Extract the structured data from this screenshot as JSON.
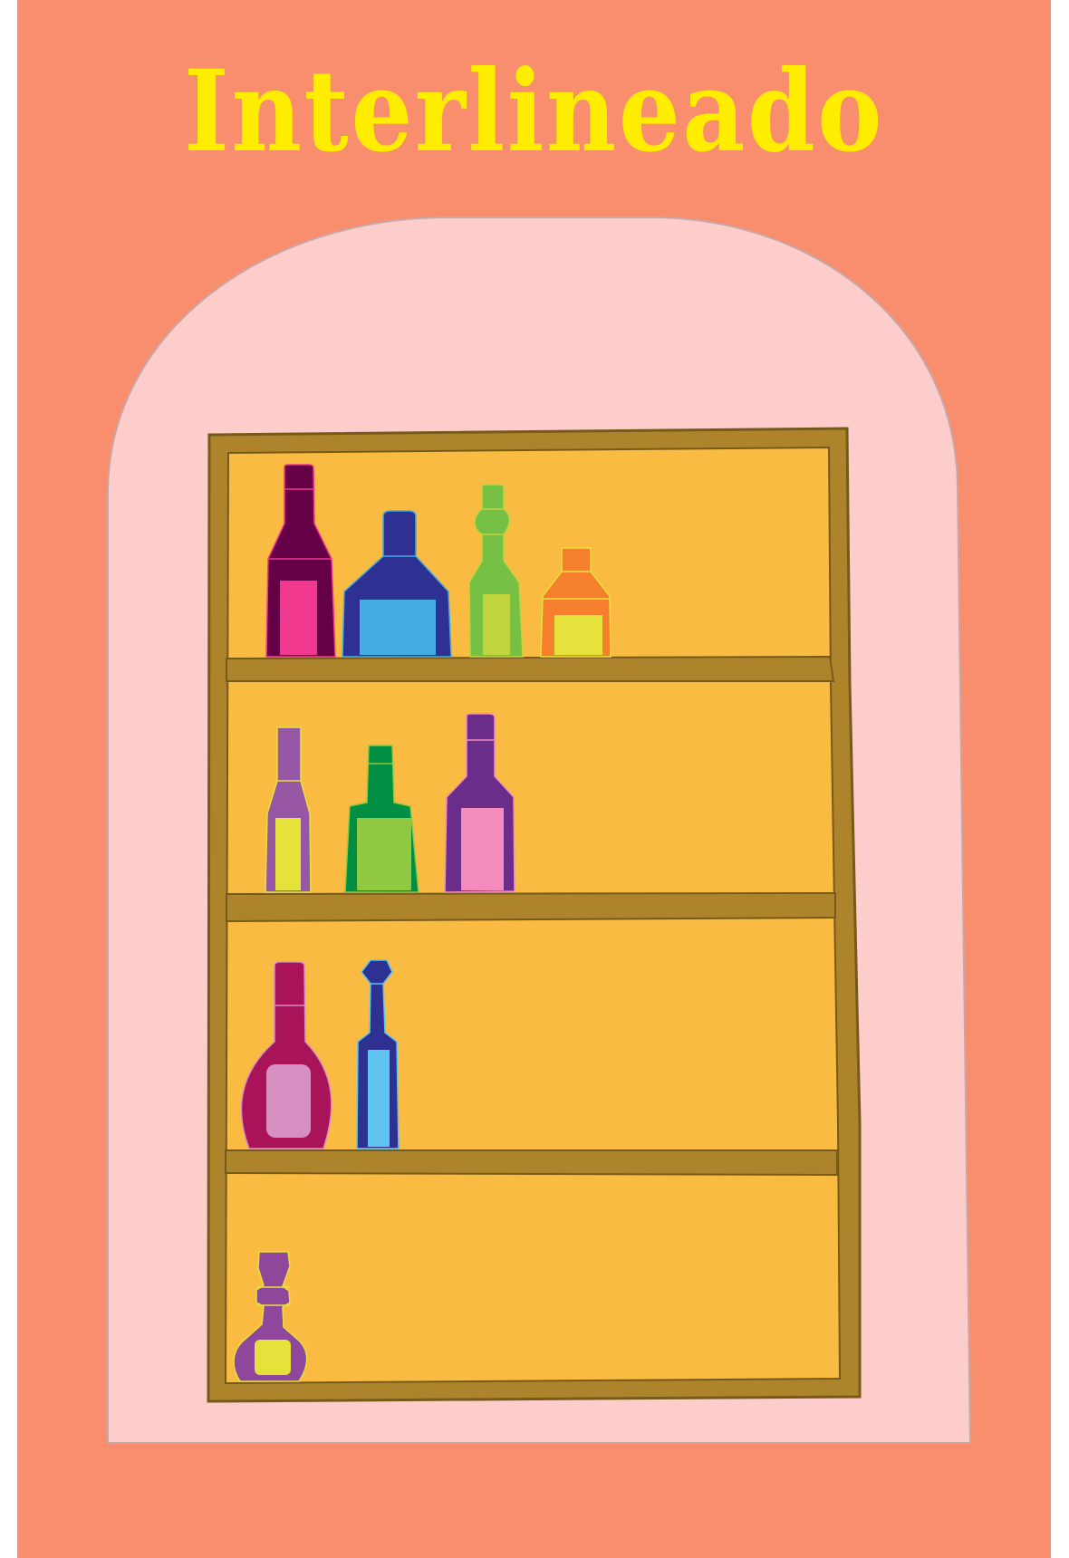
{
  "title": "Interlineado",
  "colors": {
    "background": "#f98e6f",
    "title": "#ffed00",
    "niche": "#fdcdcc",
    "niche_border": "#c8a7a7",
    "shelf_back": "#f9bb41",
    "wood": "#ad842b",
    "wood_edge": "#755a1a"
  },
  "bottles": [
    {
      "name": "wine-bottle-burgundy",
      "shelf": 1,
      "body": "#660046",
      "label": "#f1388f"
    },
    {
      "name": "squat-bottle-navy",
      "shelf": 1,
      "body": "#2e3192",
      "label": "#43ade2"
    },
    {
      "name": "tall-bottle-green",
      "shelf": 1,
      "body": "#76c045",
      "label": "#c1d63e"
    },
    {
      "name": "small-bottle-orange",
      "shelf": 1,
      "body": "#f57f2c",
      "label": "#e6e23c"
    },
    {
      "name": "slim-bottle-lavender",
      "shelf": 2,
      "body": "#9757a5",
      "label": "#e6e23c"
    },
    {
      "name": "bottle-dark-green",
      "shelf": 2,
      "body": "#008f42",
      "label": "#90c841"
    },
    {
      "name": "bottle-purple",
      "shelf": 2,
      "body": "#6b2d8a",
      "label": "#f48bbd"
    },
    {
      "name": "round-bottle-magenta",
      "shelf": 3,
      "body": "#a8135a",
      "label": "#d58fc1"
    },
    {
      "name": "thin-bottle-navy",
      "shelf": 3,
      "body": "#2e3192",
      "label": "#5fc4ef"
    },
    {
      "name": "decanter-violet",
      "shelf": 4,
      "body": "#8f479b",
      "label": "#e6e23c"
    }
  ]
}
